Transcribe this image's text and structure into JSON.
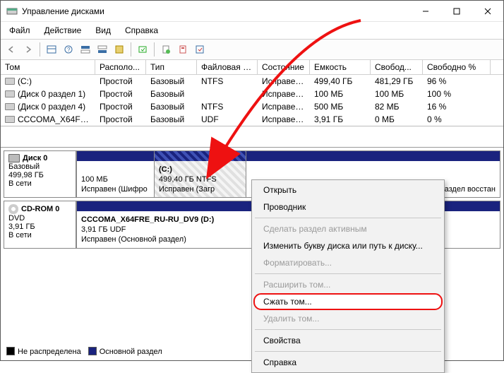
{
  "window": {
    "title": "Управление дисками"
  },
  "menu": {
    "file": "Файл",
    "action": "Действие",
    "view": "Вид",
    "help": "Справка"
  },
  "columns": [
    "Том",
    "Располо...",
    "Тип",
    "Файловая с...",
    "Состояние",
    "Емкость",
    "Свобод...",
    "Свободно %"
  ],
  "rows": [
    {
      "name": "(C:)",
      "layout": "Простой",
      "type": "Базовый",
      "fs": "NTFS",
      "status": "Исправен...",
      "cap": "499,40 ГБ",
      "free": "481,29 ГБ",
      "pct": "96 %"
    },
    {
      "name": "(Диск 0 раздел 1)",
      "layout": "Простой",
      "type": "Базовый",
      "fs": "",
      "status": "Исправен...",
      "cap": "100 МБ",
      "free": "100 МБ",
      "pct": "100 %"
    },
    {
      "name": "(Диск 0 раздел 4)",
      "layout": "Простой",
      "type": "Базовый",
      "fs": "NTFS",
      "status": "Исправен...",
      "cap": "500 МБ",
      "free": "82 МБ",
      "pct": "16 %"
    },
    {
      "name": "CCCOMA_X64FRE...",
      "layout": "Простой",
      "type": "Базовый",
      "fs": "UDF",
      "status": "Исправен...",
      "cap": "3,91 ГБ",
      "free": "0 МБ",
      "pct": "0 %"
    }
  ],
  "disk0": {
    "title": "Диск 0",
    "type": "Базовый",
    "cap": "499,98 ГБ",
    "status": "В сети",
    "p1_size": "100 МБ",
    "p1_status": "Исправен (Шифро",
    "p2_label": "(C:)",
    "p2_size": "499,40 ГБ NTFS",
    "p2_status": "Исправен (Загр",
    "p3_status": "аздел восстан"
  },
  "cdrom": {
    "title": "CD-ROM 0",
    "type": "DVD",
    "cap": "3,91 ГБ",
    "status": "В сети",
    "vol_label": "CCCOMA_X64FRE_RU-RU_DV9  (D:)",
    "vol_size": "3,91 ГБ UDF",
    "vol_status": "Исправен (Основной раздел)"
  },
  "legend": {
    "unalloc": "Не распределена",
    "primary": "Основной раздел"
  },
  "ctx": {
    "open": "Открыть",
    "explorer": "Проводник",
    "active": "Сделать раздел активным",
    "change_letter": "Изменить букву диска или путь к диску...",
    "format": "Форматировать...",
    "extend": "Расширить том...",
    "shrink": "Сжать том...",
    "delete": "Удалить том...",
    "props": "Свойства",
    "help": "Справка"
  }
}
